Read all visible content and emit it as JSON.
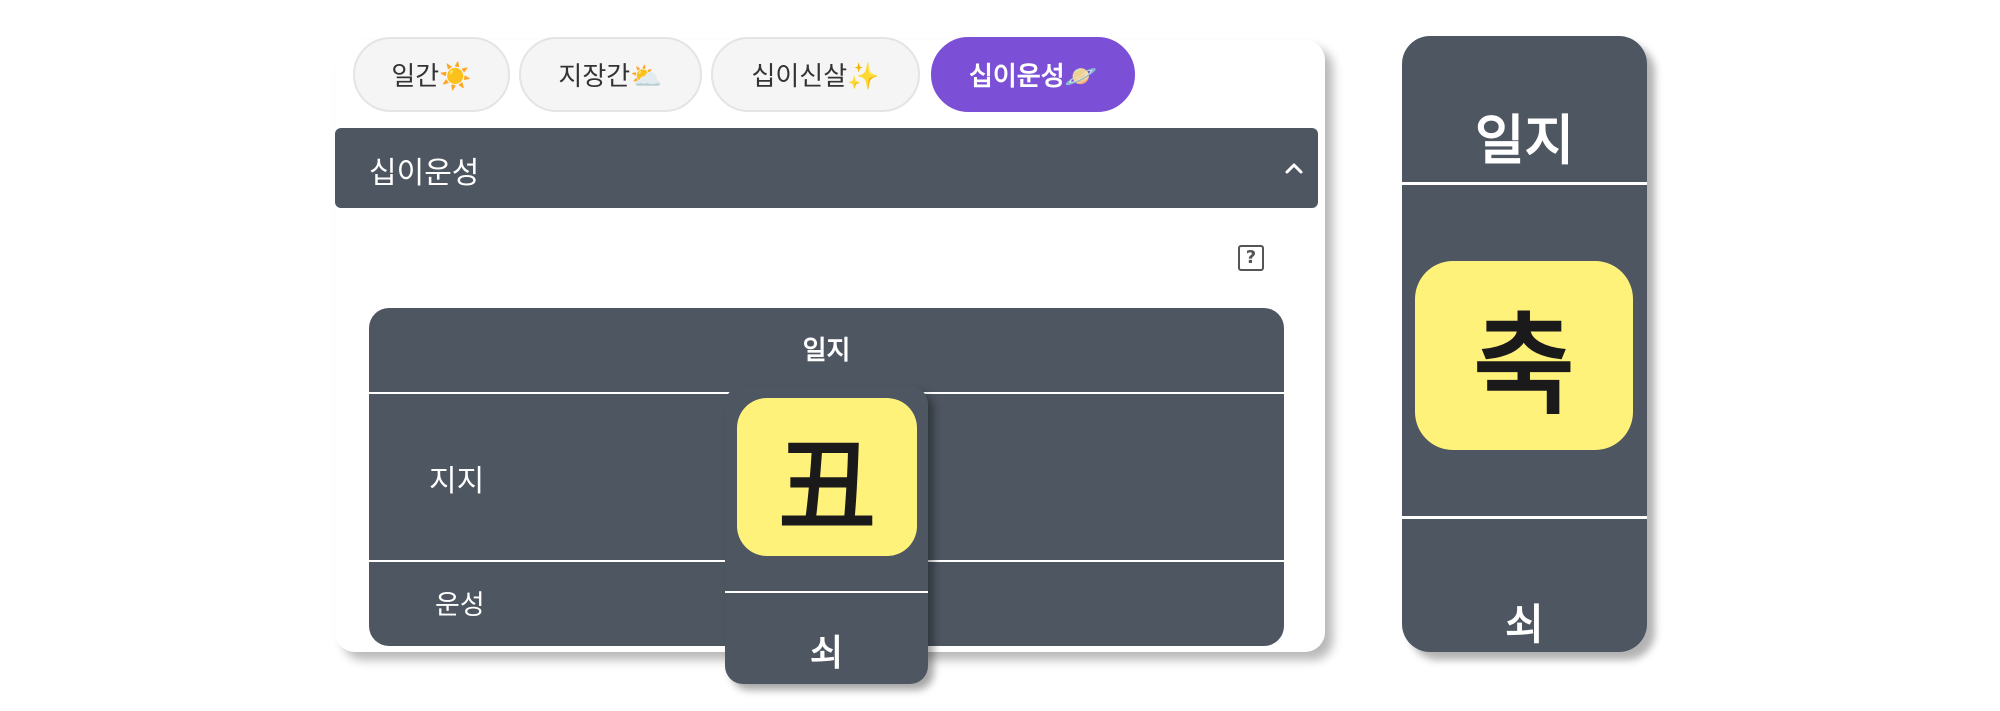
{
  "tabs": [
    {
      "label": "일간☀️",
      "active": false
    },
    {
      "label": "지장간⛅",
      "active": false
    },
    {
      "label": "십이신살✨",
      "active": false
    },
    {
      "label": "십이운성🪐",
      "active": true
    }
  ],
  "accordion": {
    "title": "십이운성",
    "expanded": true
  },
  "help": {
    "label": "?"
  },
  "table": {
    "header": "일지",
    "rows": [
      {
        "label": "지지"
      },
      {
        "label": "운성"
      }
    ]
  },
  "popout": {
    "ganji": "丑",
    "unseong": "쇠"
  },
  "side_card": {
    "header": "일지",
    "ganji": "축",
    "unseong": "쇠"
  },
  "colors": {
    "accent": "#7b4fd6",
    "panel": "#4e5661",
    "highlight": "#fff27b"
  }
}
